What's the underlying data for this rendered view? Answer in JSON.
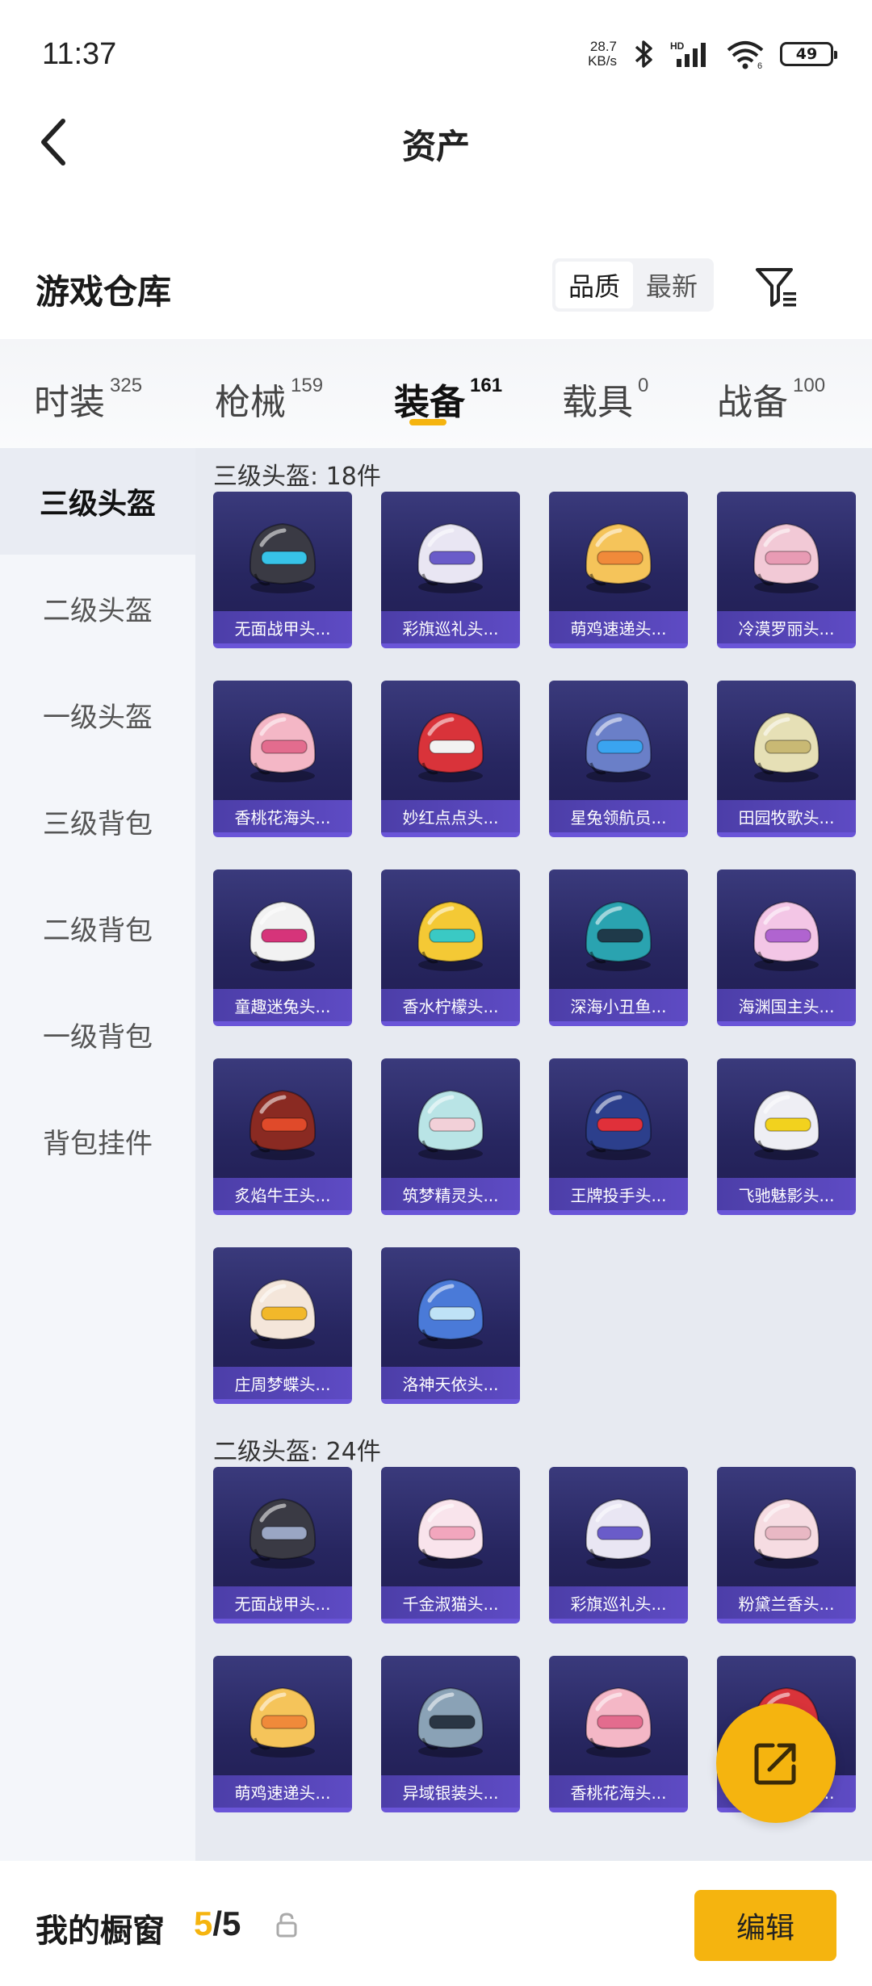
{
  "status_bar": {
    "time": "11:37",
    "net_speed_value": "28.7",
    "net_speed_unit": "KB/s",
    "battery": "49"
  },
  "header": {
    "title": "资产"
  },
  "warehouse": {
    "title": "游戏仓库",
    "sort_options": [
      "品质",
      "最新"
    ],
    "active_sort": "品质"
  },
  "categories": [
    {
      "label": "时装",
      "count": "325"
    },
    {
      "label": "枪械",
      "count": "159"
    },
    {
      "label": "装备",
      "count": "161",
      "active": true
    },
    {
      "label": "载具",
      "count": "0"
    },
    {
      "label": "战备",
      "count": "100"
    }
  ],
  "sidebar": {
    "items": [
      "三级头盔",
      "二级头盔",
      "一级头盔",
      "三级背包",
      "二级背包",
      "一级背包",
      "背包挂件"
    ],
    "active": "三级头盔"
  },
  "sections": [
    {
      "title": "三级头盔: 18件",
      "items": [
        {
          "name": "无面战甲头...",
          "color": "#3a3a44",
          "accent": "#37c3e8"
        },
        {
          "name": "彩旗巡礼头...",
          "color": "#e9e6f3",
          "accent": "#6a5cc9"
        },
        {
          "name": "萌鸡速递头...",
          "color": "#f5c45a",
          "accent": "#f08a3a"
        },
        {
          "name": "冷漠罗丽头...",
          "color": "#f2c9d6",
          "accent": "#e89bb4"
        },
        {
          "name": "香桃花海头...",
          "color": "#f4b7c6",
          "accent": "#e36c8e"
        },
        {
          "name": "妙红点点头...",
          "color": "#d9333a",
          "accent": "#f2f2f2"
        },
        {
          "name": "星兔领航员...",
          "color": "#6a7fc8",
          "accent": "#3aa4f0"
        },
        {
          "name": "田园牧歌头...",
          "color": "#e6e0b6",
          "accent": "#c9b974"
        },
        {
          "name": "童趣迷兔头...",
          "color": "#f2f2f2",
          "accent": "#d6347a"
        },
        {
          "name": "香水柠檬头...",
          "color": "#f4c935",
          "accent": "#3ac9c4"
        },
        {
          "name": "深海小丑鱼...",
          "color": "#2aa3b0",
          "accent": "#1f3a4a"
        },
        {
          "name": "海渊国主头...",
          "color": "#f3c6e6",
          "accent": "#b064d0"
        },
        {
          "name": "炙焰牛王头...",
          "color": "#8a2a22",
          "accent": "#e04a2a"
        },
        {
          "name": "筑梦精灵头...",
          "color": "#b9e4e6",
          "accent": "#f2d0d8"
        },
        {
          "name": "王牌投手头...",
          "color": "#2c3f8c",
          "accent": "#e0303a"
        },
        {
          "name": "飞驰魅影头...",
          "color": "#eeeef4",
          "accent": "#f2d21e"
        },
        {
          "name": "庄周梦蝶头...",
          "color": "#f4e6da",
          "accent": "#f2b82a"
        },
        {
          "name": "洛神天依头...",
          "color": "#4a7ad8",
          "accent": "#bfe2f6"
        }
      ]
    },
    {
      "title": "二级头盔: 24件",
      "items": [
        {
          "name": "无面战甲头...",
          "color": "#3a3a44",
          "accent": "#9aa6c4"
        },
        {
          "name": "千金淑猫头...",
          "color": "#f9e4ec",
          "accent": "#f2a6bd"
        },
        {
          "name": "彩旗巡礼头...",
          "color": "#e9e6f3",
          "accent": "#6a5cc9"
        },
        {
          "name": "粉黛兰香头...",
          "color": "#f6dce2",
          "accent": "#e9b8c4"
        },
        {
          "name": "萌鸡速递头...",
          "color": "#f5c45a",
          "accent": "#f08a3a"
        },
        {
          "name": "异域银装头...",
          "color": "#8aa2b6",
          "accent": "#2a3644"
        },
        {
          "name": "香桃花海头...",
          "color": "#f4b7c6",
          "accent": "#e36c8e"
        },
        {
          "name": "妙红点点头...",
          "color": "#d9333a",
          "accent": "#f2f2f2"
        }
      ]
    }
  ],
  "bottom": {
    "showcase_label": "我的橱窗",
    "showcase_current": "5",
    "showcase_sep": "/",
    "showcase_total": "5",
    "edit_label": "编辑"
  },
  "icons": {
    "back": "chevron-left-icon",
    "filter": "filter-icon",
    "share": "share-icon",
    "lock": "lock-icon"
  }
}
